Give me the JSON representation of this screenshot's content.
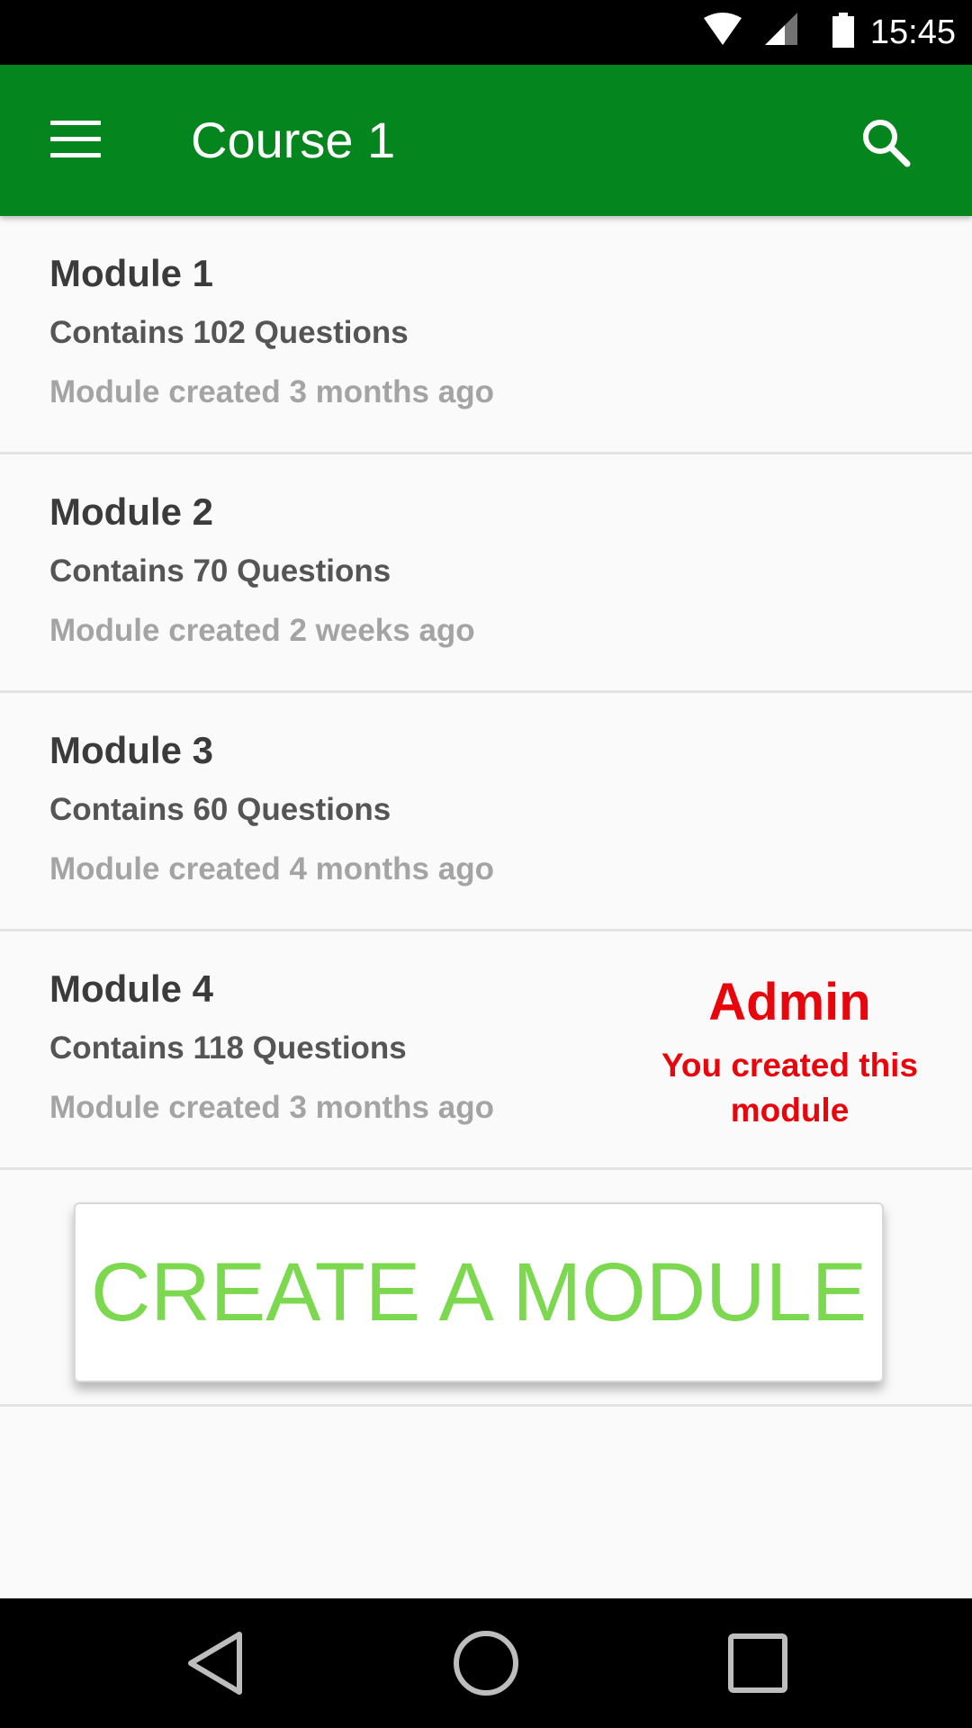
{
  "status_bar": {
    "time": "15:45",
    "icons": [
      "wifi-icon",
      "signal-icon",
      "battery-icon"
    ]
  },
  "app_bar": {
    "title": "Course 1",
    "menu_icon": "menu-icon",
    "search_icon": "search-icon",
    "color": "#05851d"
  },
  "modules": [
    {
      "name": "Module 1",
      "count": "Contains 102 Questions",
      "created": "Module created 3 months ago"
    },
    {
      "name": "Module 2",
      "count": "Contains 70 Questions",
      "created": "Module created 2 weeks ago"
    },
    {
      "name": "Module 3",
      "count": "Contains 60 Questions",
      "created": "Module created 4 months ago"
    },
    {
      "name": "Module 4",
      "count": "Contains 118 Questions",
      "created": "Module created 3 months ago",
      "admin": {
        "role": "Admin",
        "note_line1": "You created this",
        "note_line2": "module"
      }
    }
  ],
  "create_button": {
    "label": "CREATE A MODULE",
    "color": "#7bd84f"
  },
  "nav_bar": {
    "icons": [
      "back-icon",
      "home-icon",
      "recents-icon"
    ]
  },
  "colors": {
    "admin": "#e8050c"
  }
}
